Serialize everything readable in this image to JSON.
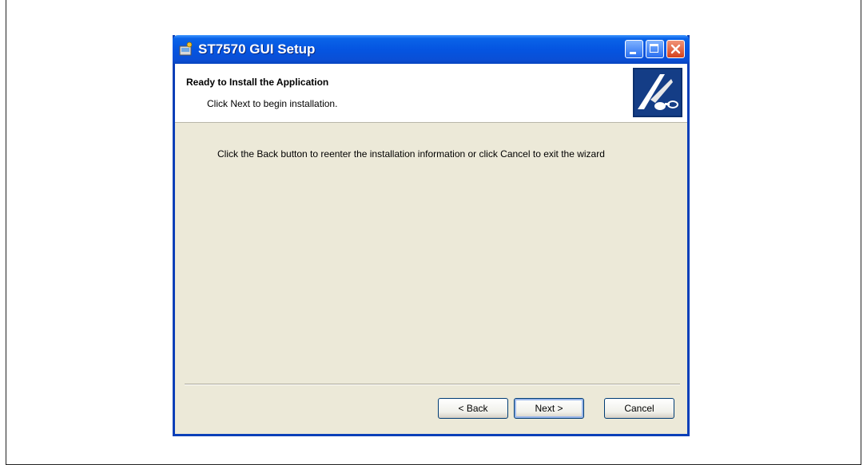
{
  "window": {
    "title": "ST7570 GUI Setup"
  },
  "header": {
    "title": "Ready to Install the Application",
    "subtitle": "Click Next to begin installation."
  },
  "body": {
    "message": "Click the Back button to reenter the installation information or click Cancel to exit the wizard"
  },
  "buttons": {
    "back": "< Back",
    "next": "Next >",
    "cancel": "Cancel"
  },
  "icons": {
    "app": "setup-app-icon",
    "logo": "installer-logo",
    "minimize": "minimize-icon",
    "maximize": "maximize-icon",
    "close": "close-icon"
  },
  "colors": {
    "titlebar": "#0555e1",
    "window_bg": "#ece9d8",
    "close": "#d6421e"
  }
}
